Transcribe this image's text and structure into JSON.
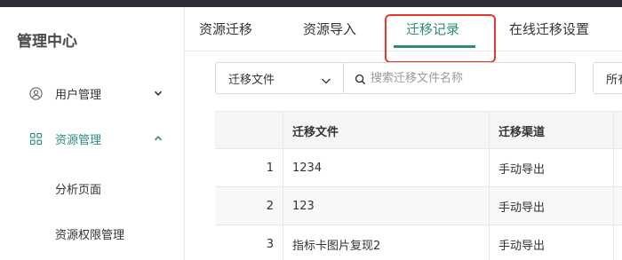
{
  "sidebar": {
    "title": "管理中心",
    "items": [
      {
        "label": "用户管理",
        "icon": "user-circle-icon",
        "expanded": false
      },
      {
        "label": "资源管理",
        "icon": "grid-icon",
        "expanded": true
      }
    ],
    "sub_items": [
      {
        "label": "分析页面"
      },
      {
        "label": "资源权限管理"
      }
    ]
  },
  "tabs": [
    {
      "label": "资源迁移"
    },
    {
      "label": "资源导入"
    },
    {
      "label": "迁移记录",
      "active": true
    },
    {
      "label": "在线迁移设置"
    }
  ],
  "filter": {
    "select_value": "迁移文件",
    "search_placeholder": "搜索迁移文件名称",
    "extra_label": "所有"
  },
  "table": {
    "headers": [
      "",
      "迁移文件",
      "迁移渠道"
    ],
    "rows": [
      {
        "index": "1",
        "file": "1234",
        "channel": "手动导出"
      },
      {
        "index": "2",
        "file": "123",
        "channel": "手动导出"
      },
      {
        "index": "3",
        "file": "指标卡图片复现2",
        "channel": "手动导出"
      }
    ]
  },
  "colors": {
    "accent": "#2e8b7a",
    "highlight": "#e5382c",
    "topbar": "#2b2f33"
  }
}
